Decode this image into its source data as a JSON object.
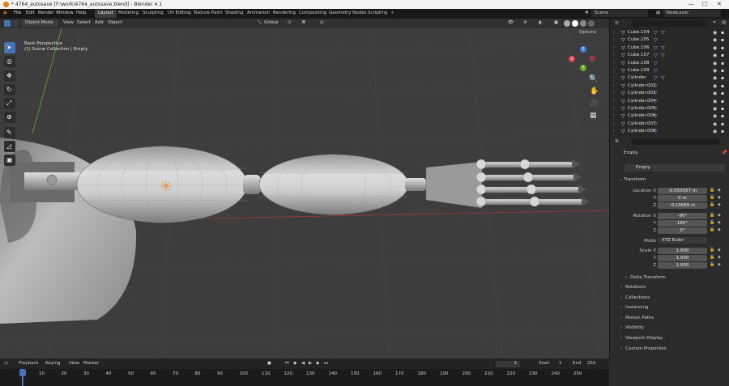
{
  "window": {
    "title": "* 4764_autosave [F:\\work\\4764_autosave.blend] - Blender 4.1"
  },
  "menubar": {
    "items": [
      "File",
      "Edit",
      "Render",
      "Window",
      "Help"
    ]
  },
  "workspaces": [
    {
      "label": "Layout",
      "active": true
    },
    {
      "label": "Modeling",
      "active": false
    },
    {
      "label": "Sculpting",
      "active": false
    },
    {
      "label": "UV Editing",
      "active": false
    },
    {
      "label": "Texture Paint",
      "active": false
    },
    {
      "label": "Shading",
      "active": false
    },
    {
      "label": "Animation",
      "active": false
    },
    {
      "label": "Rendering",
      "active": false
    },
    {
      "label": "Compositing",
      "active": false
    },
    {
      "label": "Geometry Nodes",
      "active": false
    },
    {
      "label": "Scripting",
      "active": false
    }
  ],
  "scene": {
    "scene_label": "Scene",
    "view_layer_label": "ViewLayer"
  },
  "viewport_header": {
    "mode": "Object Mode",
    "menus": [
      "View",
      "Select",
      "Add",
      "Object"
    ],
    "orientation": "Global",
    "options": "Options"
  },
  "viewport": {
    "perspective": "Back Perspective",
    "collection_info": "(1) Scene Collection | Empty",
    "gizmo_axes": {
      "x": "X",
      "y": "Y",
      "z": "Z"
    }
  },
  "outliner": {
    "items": [
      {
        "name": "Cube.104",
        "mods": 2
      },
      {
        "name": "Cube.105",
        "mods": 1
      },
      {
        "name": "Cube.106",
        "mods": 2
      },
      {
        "name": "Cube.107",
        "mods": 2
      },
      {
        "name": "Cube.108",
        "mods": 1
      },
      {
        "name": "Cube.109",
        "mods": 1
      },
      {
        "name": "Cylinder",
        "mods": 2
      },
      {
        "name": "Cylinder.002",
        "mods": 1
      },
      {
        "name": "Cylinder.003",
        "mods": 1
      },
      {
        "name": "Cylinder.004",
        "mods": 1
      },
      {
        "name": "Cylinder.005",
        "mods": 1
      },
      {
        "name": "Cylinder.006",
        "mods": 1
      },
      {
        "name": "Cylinder.007",
        "mods": 1
      },
      {
        "name": "Cylinder.008",
        "mods": 1
      }
    ]
  },
  "properties": {
    "object_name": "Empty",
    "object_field": "Empty",
    "transform_header": "Transform",
    "location": {
      "label_x": "Location X",
      "x": "-0.050587 m",
      "label_y": "Y",
      "y": "0 m",
      "label_z": "Z",
      "z": "-0.19689 m"
    },
    "rotation": {
      "label_x": "Rotation X",
      "x": "-90°",
      "label_y": "Y",
      "y": "180°",
      "label_z": "Z",
      "z": "0°"
    },
    "mode": {
      "label": "Mode",
      "value": "XYZ Euler"
    },
    "scale": {
      "label_x": "Scale X",
      "x": "1.000",
      "label_y": "Y",
      "y": "1.000",
      "label_z": "Z",
      "z": "1.000"
    },
    "delta_transform": "Delta Transform",
    "sections": [
      "Relations",
      "Collections",
      "Instancing",
      "Motion Paths",
      "Visibility",
      "Viewport Display",
      "Custom Properties"
    ]
  },
  "timeline": {
    "menus": [
      "Playback",
      "Keying",
      "View",
      "Marker"
    ],
    "current_frame": "1",
    "start_label": "Start",
    "start": "1",
    "end_label": "End",
    "end": "250",
    "ticks": [
      "1",
      "10",
      "20",
      "30",
      "40",
      "50",
      "60",
      "70",
      "80",
      "90",
      "100",
      "110",
      "120",
      "130",
      "140",
      "150",
      "160",
      "170",
      "180",
      "190",
      "200",
      "210",
      "220",
      "230",
      "240",
      "250"
    ]
  },
  "colors": {
    "accent": "#4772b3",
    "axis_x": "#e8414e",
    "axis_y": "#6aa828",
    "axis_z": "#3d7fe0",
    "frame_marker": "#4772b3"
  }
}
